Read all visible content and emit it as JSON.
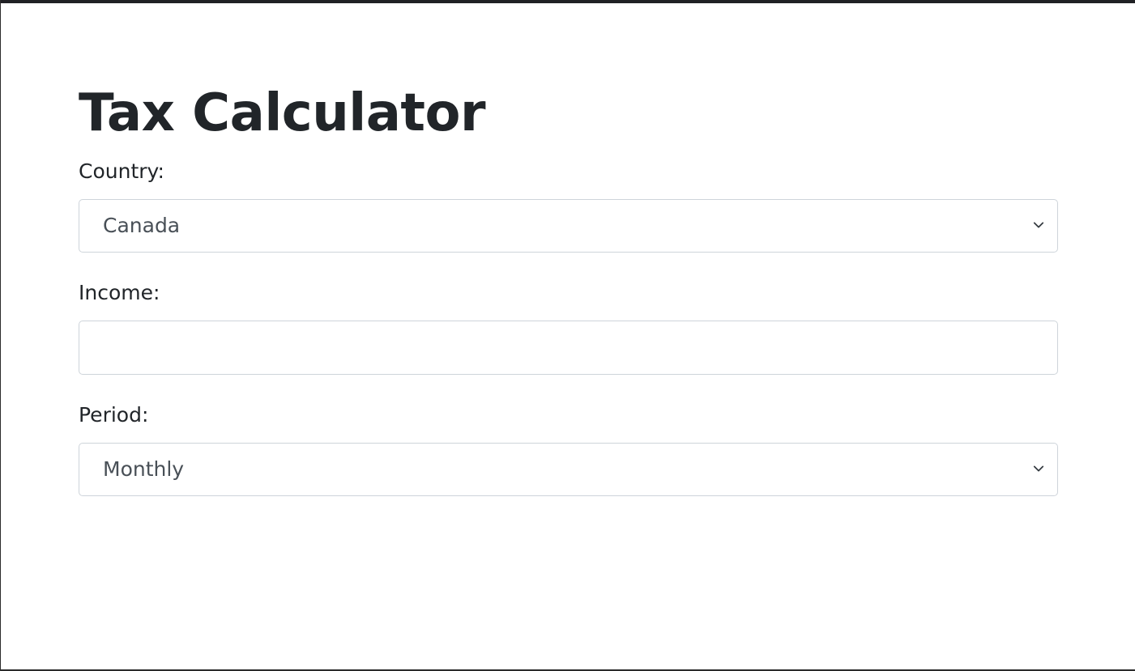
{
  "page": {
    "title": "Tax Calculator"
  },
  "form": {
    "country": {
      "label": "Country:",
      "selected": "Canada",
      "icon": "chevron-down-icon"
    },
    "income": {
      "label": "Income:",
      "value": "",
      "placeholder": ""
    },
    "period": {
      "label": "Period:",
      "selected": "Monthly",
      "icon": "chevron-down-icon"
    }
  },
  "colors": {
    "heading": "#212529",
    "field_text": "#495057",
    "border": "#ced4da"
  }
}
